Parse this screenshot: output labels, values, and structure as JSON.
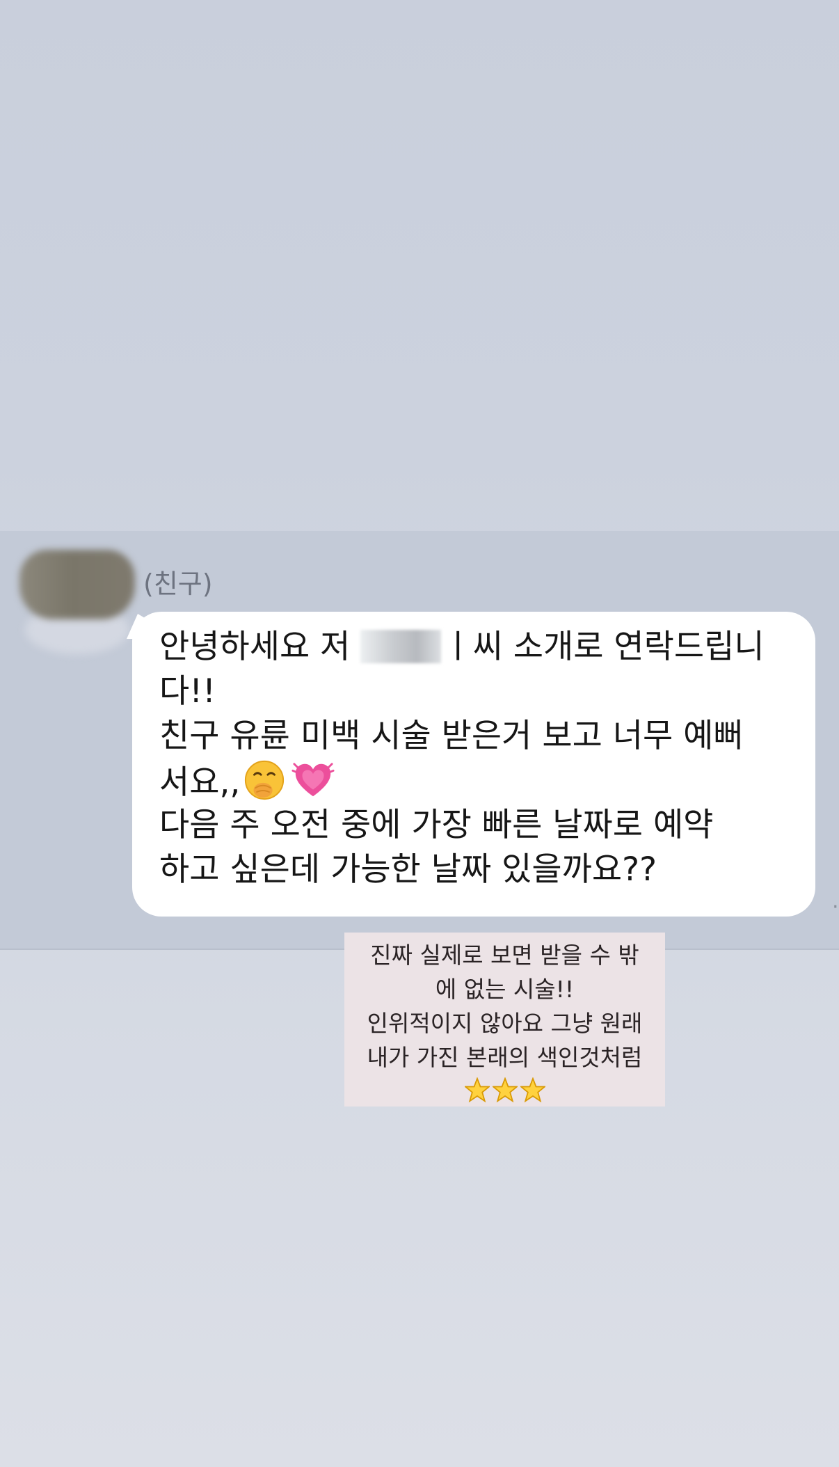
{
  "chat": {
    "sender_name": "(친구)",
    "message_lines": {
      "line1_before": "안녕하세요 저 ",
      "line1_after": "ㅣ씨 소개로 연락드립니",
      "line2": "다!!",
      "line3": "친구 유륜 미백 시술 받은거 보고 너무 예뻐",
      "line4_text": "서요,,",
      "line5": "다음 주 오전 중에 가장 빠른 날짜로 예약",
      "line6": "하고 싶은데 가능한 날짜 있을까요??"
    },
    "emojis": [
      "face-with-hand-over-mouth-icon",
      "beating-heart-icon"
    ]
  },
  "caption": {
    "line1": "진짜 실제로 보면 받을 수 밖",
    "line2": "에 없는 시술!!",
    "line3": "인위적이지 않아요 그냥 원래",
    "line4": "내가 가진 본래의 색인것처럼",
    "stars": [
      "star-icon",
      "star-icon",
      "star-icon"
    ]
  },
  "colors": {
    "background": "#ccd2de",
    "chat_band": "#c3cad7",
    "bubble": "#ffffff",
    "caption_bg": "#ece3e6",
    "text": "#161616",
    "sender_name": "#6d7380"
  }
}
